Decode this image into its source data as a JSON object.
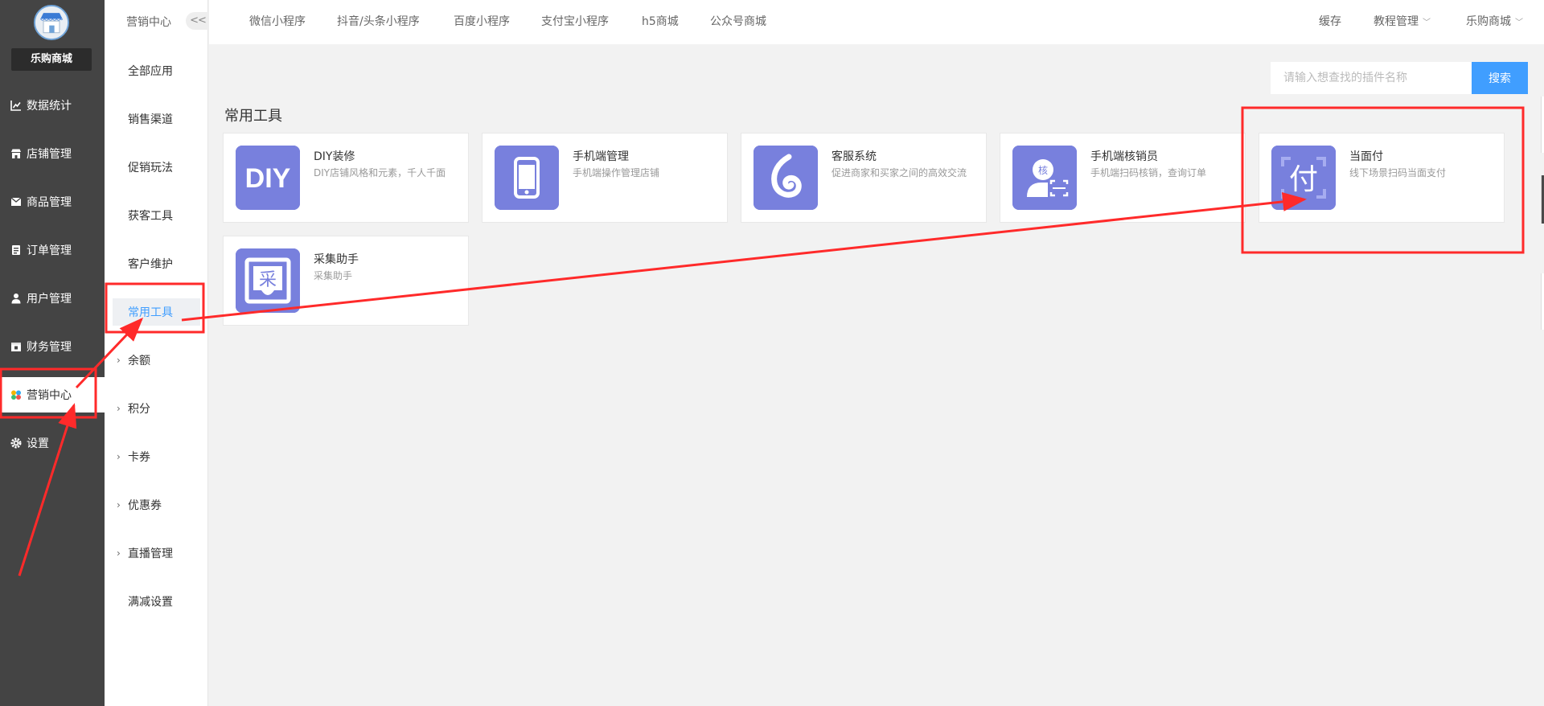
{
  "sidebar": {
    "brand": "乐购商城",
    "items": [
      {
        "label": "数据统计",
        "icon": "chart-line-icon"
      },
      {
        "label": "店铺管理",
        "icon": "store-icon"
      },
      {
        "label": "商品管理",
        "icon": "goods-icon"
      },
      {
        "label": "订单管理",
        "icon": "order-icon"
      },
      {
        "label": "用户管理",
        "icon": "user-icon"
      },
      {
        "label": "财务管理",
        "icon": "finance-icon"
      },
      {
        "label": "营销中心",
        "icon": "marketing-icon",
        "active": true
      },
      {
        "label": "设置",
        "icon": "gear-icon"
      }
    ]
  },
  "subnav": {
    "title": "营销中心",
    "collapse_label": "<<",
    "items": [
      {
        "label": "全部应用"
      },
      {
        "label": "销售渠道"
      },
      {
        "label": "促销玩法"
      },
      {
        "label": "获客工具"
      },
      {
        "label": "客户维护"
      },
      {
        "label": "常用工具",
        "active": true
      },
      {
        "label": "余额",
        "expandable": true
      },
      {
        "label": "积分",
        "expandable": true
      },
      {
        "label": "卡券",
        "expandable": true
      },
      {
        "label": "优惠券",
        "expandable": true
      },
      {
        "label": "直播管理",
        "expandable": true
      },
      {
        "label": "满减设置"
      }
    ]
  },
  "topbar": {
    "tabs": [
      "微信小程序",
      "抖音/头条小程序",
      "百度小程序",
      "支付宝小程序",
      "h5商城",
      "公众号商城"
    ],
    "cache": "缓存",
    "tutorial": "教程管理",
    "shop": "乐购商城"
  },
  "search": {
    "placeholder": "请输入想查找的插件名称",
    "button": "搜索"
  },
  "section": {
    "title": "常用工具"
  },
  "tools": [
    {
      "title": "DIY装修",
      "desc": "DIY店铺风格和元素，千人千面",
      "icon": "diy-icon",
      "icon_text": "DIY"
    },
    {
      "title": "手机端管理",
      "desc": "手机端操作管理店铺",
      "icon": "mobile-phone-icon"
    },
    {
      "title": "客服系统",
      "desc": "促进商家和买家之间的高效交流",
      "icon": "customer-service-icon"
    },
    {
      "title": "手机端核销员",
      "desc": "手机端扫码核销，查询订单",
      "icon": "verifier-icon",
      "icon_text": "核"
    },
    {
      "title": "当面付",
      "desc": "线下场景扫码当面支付",
      "icon": "face-pay-icon",
      "icon_text": "付"
    },
    {
      "title": "采集助手",
      "desc": "采集助手",
      "icon": "collect-icon",
      "icon_text": "采"
    }
  ],
  "colors": {
    "sidebar_bg": "#444444",
    "accent": "#409eff",
    "icon_bg": "#7880dd",
    "annotation": "#ff2a2a"
  }
}
